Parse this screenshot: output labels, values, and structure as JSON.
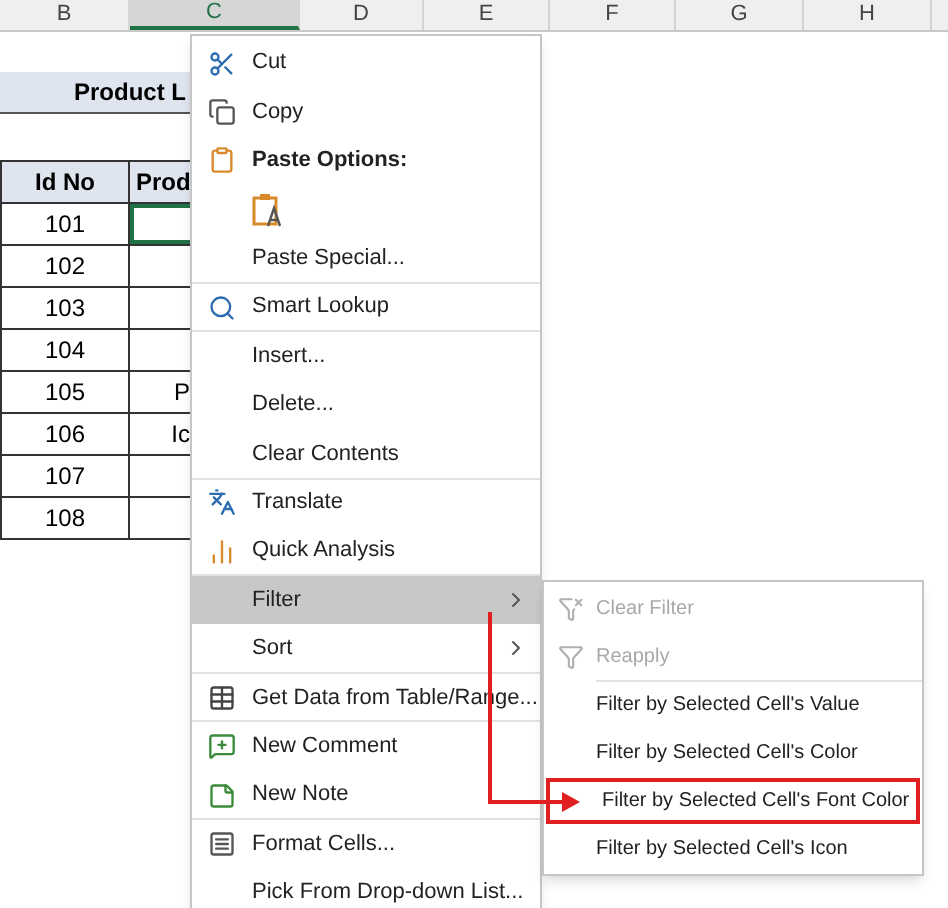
{
  "column_headers": [
    {
      "label": "B",
      "selected": false
    },
    {
      "label": "C",
      "selected": true
    },
    {
      "label": "D",
      "selected": false
    },
    {
      "label": "E",
      "selected": false
    },
    {
      "label": "F",
      "selected": false
    },
    {
      "label": "G",
      "selected": false
    },
    {
      "label": "H",
      "selected": false
    }
  ],
  "sheet": {
    "title": "Product L",
    "columns": [
      "Id No",
      "Prod"
    ],
    "rows": [
      {
        "id": "101",
        "selected": true
      },
      {
        "id": "102",
        "selected": false
      },
      {
        "id": "103",
        "selected": false
      },
      {
        "id": "104",
        "selected": false
      },
      {
        "id": "105",
        "product": "P",
        "selected": false
      },
      {
        "id": "106",
        "product": "Ic",
        "selected": false
      },
      {
        "id": "107",
        "selected": false
      },
      {
        "id": "108",
        "selected": false
      }
    ]
  },
  "context_menu": {
    "items": [
      {
        "kind": "command",
        "label": "Cut",
        "selected": false,
        "divider_above": false
      },
      {
        "kind": "command",
        "label": "Copy",
        "selected": false,
        "divider_above": false
      },
      {
        "kind": "heading",
        "label": "Paste Options:",
        "divider_above": false
      },
      {
        "kind": "paste-option",
        "divider_above": false
      },
      {
        "kind": "command",
        "label": "Paste Special...",
        "selected": false,
        "divider_above": false
      },
      {
        "kind": "command",
        "label": "Smart Lookup",
        "selected": false,
        "divider_above": true
      },
      {
        "kind": "command",
        "label": "Insert...",
        "selected": false,
        "divider_above": true
      },
      {
        "kind": "command",
        "label": "Delete...",
        "selected": false,
        "divider_above": false
      },
      {
        "kind": "command",
        "label": "Clear Contents",
        "selected": false,
        "divider_above": false
      },
      {
        "kind": "command",
        "label": "Translate",
        "selected": false,
        "divider_above": true
      },
      {
        "kind": "command",
        "label": "Quick Analysis",
        "selected": false,
        "divider_above": false
      },
      {
        "kind": "submenu",
        "label": "Filter",
        "selected": true,
        "divider_above": true
      },
      {
        "kind": "submenu",
        "label": "Sort",
        "selected": false,
        "divider_above": false
      },
      {
        "kind": "command",
        "label": "Get Data from Table/Range...",
        "selected": false,
        "divider_above": true
      },
      {
        "kind": "command",
        "label": "New Comment",
        "selected": false,
        "divider_above": true
      },
      {
        "kind": "command",
        "label": "New Note",
        "selected": false,
        "divider_above": false
      },
      {
        "kind": "command",
        "label": "Format Cells...",
        "selected": false,
        "divider_above": true
      },
      {
        "kind": "command",
        "label": "Pick From Drop-down List...",
        "selected": false,
        "divider_above": false
      }
    ]
  },
  "filter_submenu": {
    "items": [
      {
        "label": "Clear Filter",
        "disabled": true,
        "highlighted": false,
        "divider_above": false
      },
      {
        "label": "Reapply",
        "disabled": true,
        "highlighted": false,
        "divider_above": false
      },
      {
        "label": "Filter by Selected Cell's Value",
        "disabled": false,
        "highlighted": false,
        "divider_above": true
      },
      {
        "label": "Filter by Selected Cell's Color",
        "disabled": false,
        "highlighted": false,
        "divider_above": false
      },
      {
        "label": "Filter by Selected Cell's Font Color",
        "disabled": false,
        "highlighted": true,
        "divider_above": false
      },
      {
        "label": "Filter by Selected Cell's Icon",
        "disabled": false,
        "highlighted": false,
        "divider_above": false
      }
    ]
  }
}
